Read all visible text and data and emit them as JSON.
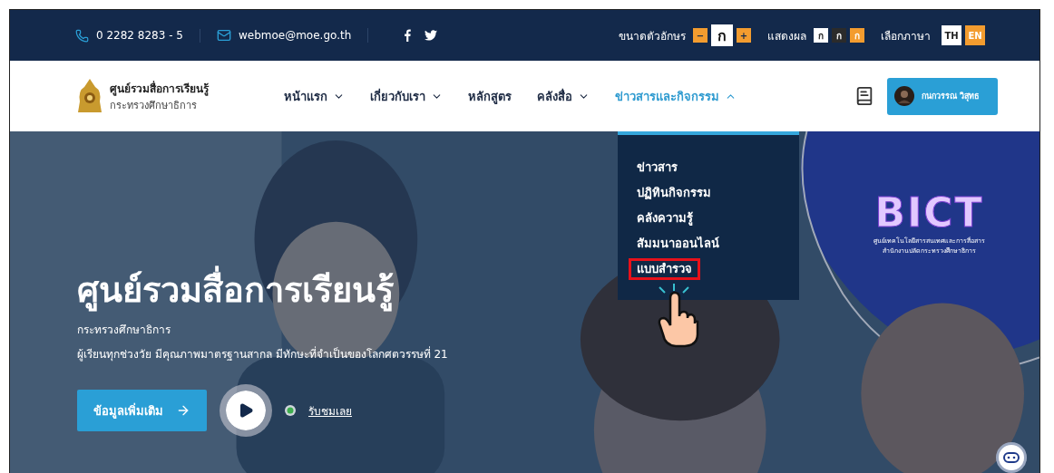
{
  "top_bar": {
    "phone": "0 2282 8283 - 5",
    "email": "webmoe@moe.go.th",
    "font_size": {
      "label": "ขนาดตัวอักษร",
      "decrease": "−",
      "sample": "ก",
      "increase": "+"
    },
    "display": {
      "label": "แสดงผล",
      "modes": [
        {
          "text": "ก",
          "color": "#ffffff"
        },
        {
          "text": "ก",
          "color": "#2b2b2b"
        },
        {
          "text": "ก",
          "color": "#f39c2f"
        }
      ]
    },
    "language": {
      "label": "เลือกภาษา",
      "options": [
        {
          "label": "TH",
          "selected": true
        },
        {
          "label": "EN",
          "selected": false
        }
      ]
    }
  },
  "header": {
    "site_name": "ศูนย์รวมสื่อการเรียนรู้",
    "ministry": "กระทรวงศึกษาธิการ",
    "nav": [
      {
        "label": "หน้าแรก",
        "has_menu": true,
        "expanded": false
      },
      {
        "label": "เกี่ยวกับเรา",
        "has_menu": true,
        "expanded": false
      },
      {
        "label": "หลักสูตร",
        "has_menu": false,
        "expanded": false
      },
      {
        "label": "คลังสื่อ",
        "has_menu": true,
        "expanded": false
      },
      {
        "label": "ข่าวสารและกิจกรรม",
        "has_menu": true,
        "expanded": true
      }
    ],
    "user": {
      "name": "กนกวรรณ วิสุทธ"
    }
  },
  "dropdown": {
    "items": [
      {
        "label": "ข่าวสาร",
        "highlighted": false
      },
      {
        "label": "ปฏิทินกิจกรรม",
        "highlighted": false
      },
      {
        "label": "คลังความรู้",
        "highlighted": false
      },
      {
        "label": "สัมมนาออนไลน์",
        "highlighted": false
      },
      {
        "label": "แบบสำรวจ",
        "highlighted": true
      }
    ]
  },
  "hero": {
    "title": "ศูนย์รวมสื่อการเรียนรู้",
    "subtitle": "กระทรวงศึกษาธิการ",
    "tagline": "ผู้เรียนทุกช่วงวัย มีคุณภาพมาตรฐานสากล มีทักษะที่จำเป็นของโลกศตวรรษที่ 21",
    "more_button": "ข้อมูลเพิ่มเติม",
    "watch_link": "รับชมเลย",
    "badge": {
      "letters": "BICT",
      "line_1": "ศูนย์เทคโนโลยีสารสนเทศและการสื่อสาร",
      "line_2": "สำนักงานปลัดกระทรวงศึกษาธิการ"
    }
  }
}
